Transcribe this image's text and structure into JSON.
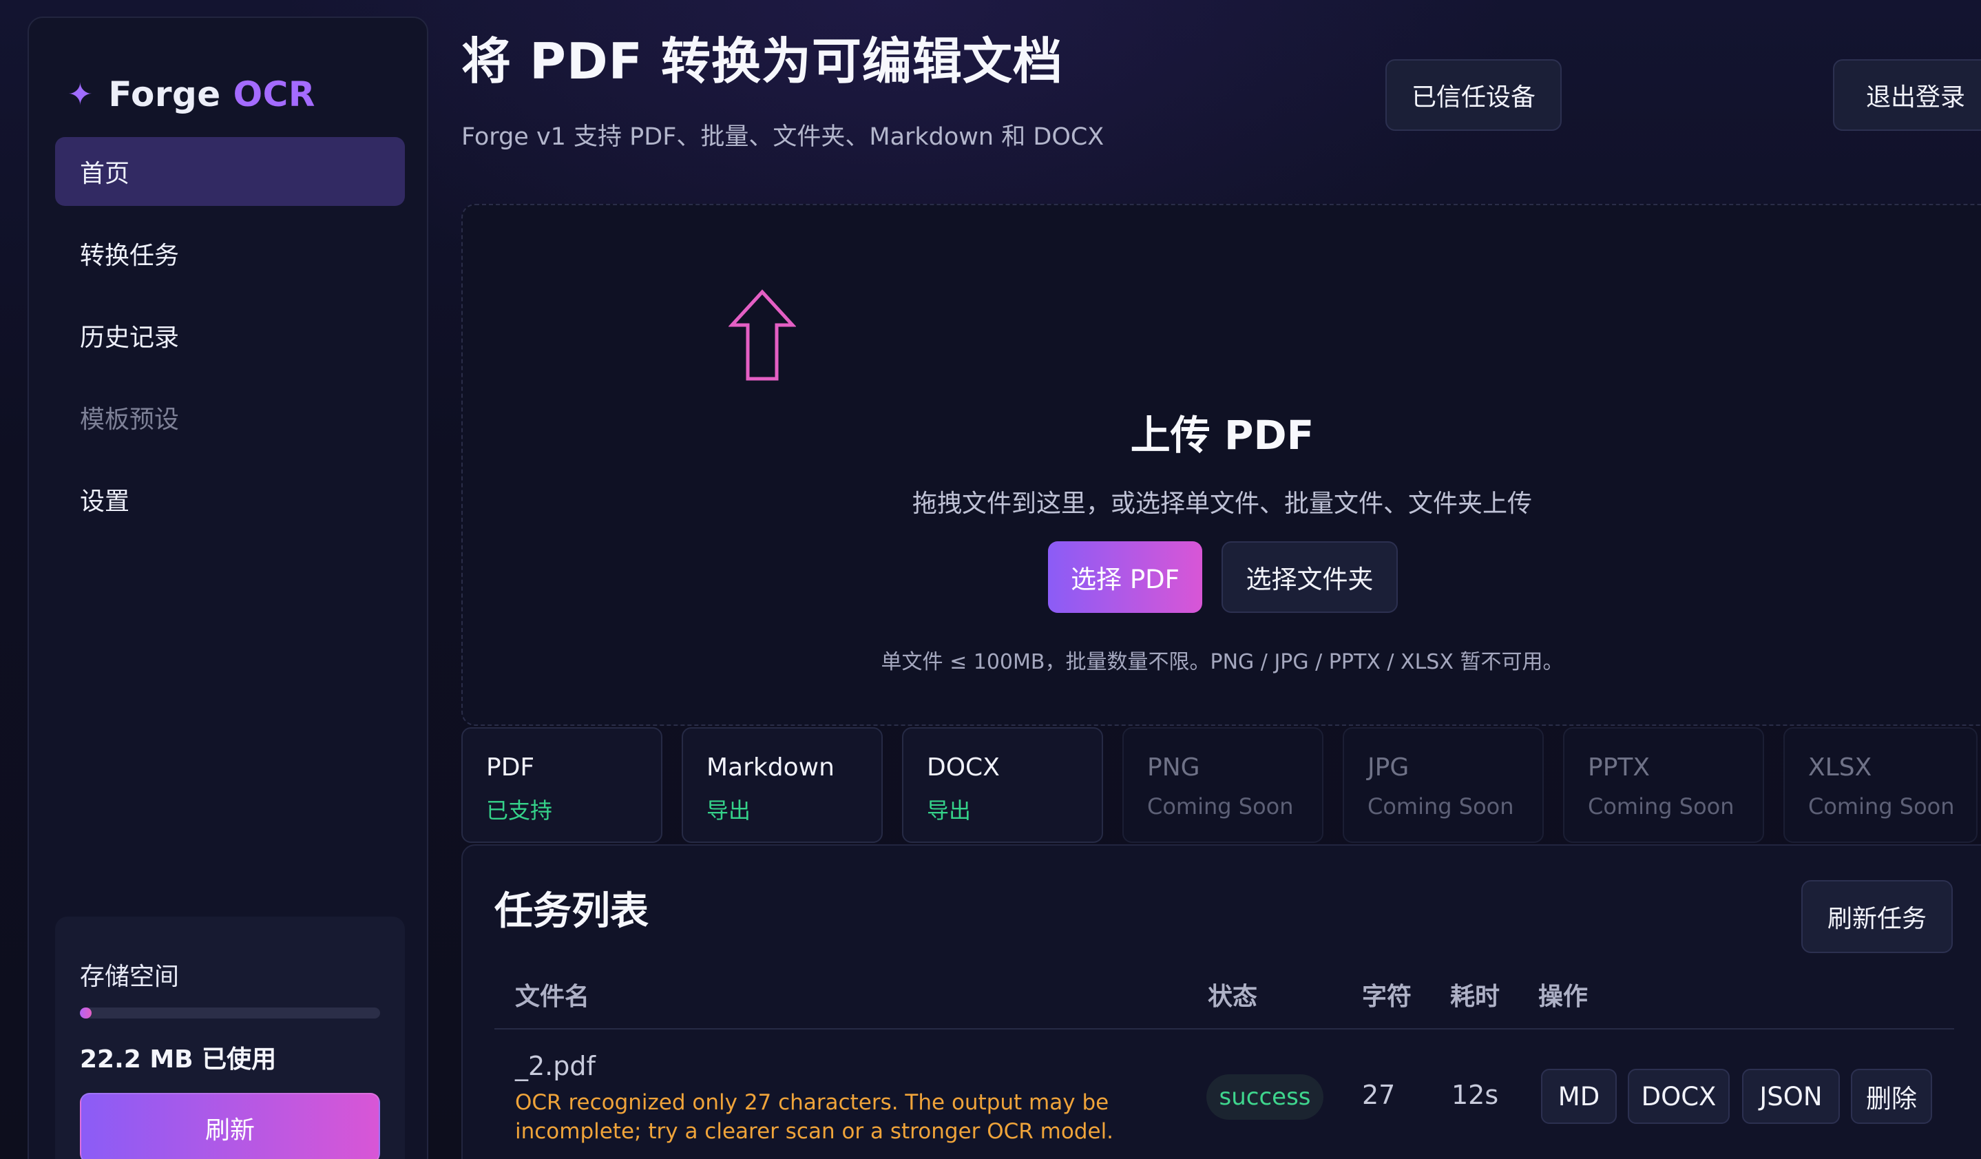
{
  "brand": {
    "icon": "sparkle-icon",
    "name": "Forge",
    "accent": "OCR"
  },
  "sidebar": {
    "items": [
      {
        "label": "首页",
        "active": true
      },
      {
        "label": "转换任务"
      },
      {
        "label": "历史记录"
      },
      {
        "label": "模板预设",
        "disabled": true
      },
      {
        "label": "设置"
      }
    ],
    "storage": {
      "label": "存储空间",
      "used_label": "22.2 MB 已使用",
      "used_fraction": 0.04,
      "refresh_label": "刷新"
    }
  },
  "header": {
    "title": "将 PDF 转换为可编辑文档",
    "subtitle": "Forge v1 支持 PDF、批量、文件夹、Markdown 和 DOCX",
    "trusted_devices_label": "已信任设备",
    "logout_label": "退出登录"
  },
  "upload": {
    "icon": "upload-arrow-icon",
    "title": "上传 PDF",
    "description": "拖拽文件到这里，或选择单文件、批量文件、文件夹上传",
    "choose_pdf_label": "选择 PDF",
    "choose_folder_label": "选择文件夹",
    "note": "单文件 ≤ 100MB，批量数量不限。PNG / JPG / PPTX / XLSX 暂不可用。"
  },
  "formats": [
    {
      "name": "PDF",
      "status": "已支持",
      "enabled": true
    },
    {
      "name": "Markdown",
      "status": "导出",
      "enabled": true
    },
    {
      "name": "DOCX",
      "status": "导出",
      "enabled": true
    },
    {
      "name": "PNG",
      "status": "Coming Soon",
      "enabled": false
    },
    {
      "name": "JPG",
      "status": "Coming Soon",
      "enabled": false
    },
    {
      "name": "PPTX",
      "status": "Coming Soon",
      "enabled": false
    },
    {
      "name": "XLSX",
      "status": "Coming Soon",
      "enabled": false
    }
  ],
  "tasks": {
    "title": "任务列表",
    "refresh_label": "刷新任务",
    "columns": [
      "文件名",
      "状态",
      "字符",
      "耗时",
      "操作"
    ],
    "rows": [
      {
        "file": "_2.pdf",
        "warning": "OCR recognized only 27 characters. The output may be incomplete; try a clearer scan or a stronger OCR model.",
        "status": "success",
        "chars": "27",
        "time": "12s",
        "actions": [
          "MD",
          "DOCX",
          "JSON",
          "删除"
        ]
      }
    ]
  },
  "colors": {
    "accent_purple": "#8b5cf6",
    "accent_pink": "#d856d6",
    "success_green": "#3fd68e",
    "warning_orange": "#f0a43a",
    "background": "#0e0f1e"
  }
}
